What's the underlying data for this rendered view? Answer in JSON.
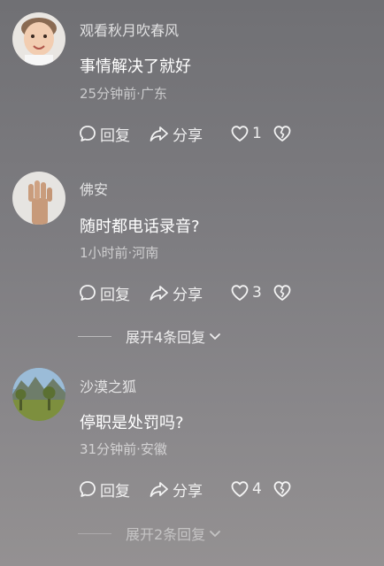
{
  "comments": [
    {
      "username": "观看秋月吹春风",
      "content": "事情解决了就好",
      "meta": "25分钟前·广东",
      "reply_label": "回复",
      "share_label": "分享",
      "like_count": "1"
    },
    {
      "username": "佛安",
      "content": "随时都电话录音?",
      "meta": "1小时前·河南",
      "reply_label": "回复",
      "share_label": "分享",
      "like_count": "3",
      "expand_label": "展开4条回复"
    },
    {
      "username": "沙漠之狐",
      "content": "停职是处罚吗?",
      "meta": "31分钟前·安徽",
      "reply_label": "回复",
      "share_label": "分享",
      "like_count": "4",
      "expand_label": "展开2条回复"
    }
  ],
  "icons": {
    "reply": "chat-bubble-icon",
    "share": "share-arrow-icon",
    "like": "heart-icon",
    "dislike": "broken-heart-icon",
    "expand": "chevron-down-icon"
  }
}
